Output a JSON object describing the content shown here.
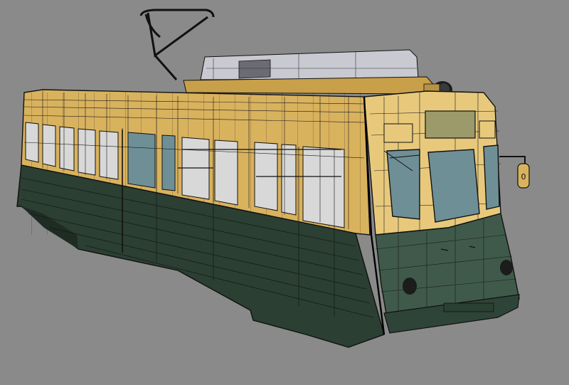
{
  "viewport": {
    "background": "#8a8a8a"
  },
  "model": {
    "kind": "tram-wireframe-render",
    "colors": {
      "upper_body": "#d9b25e",
      "upper_body_front": "#e8c97c",
      "lower_body": "#2b3f33",
      "lower_body_front": "#3f5a4a",
      "roof_unit": "#c9c9d2",
      "wire": "#1a1a1a",
      "glass": "#6f8f96",
      "interior": "#d8d8d8"
    },
    "front_number_plate": "0"
  }
}
